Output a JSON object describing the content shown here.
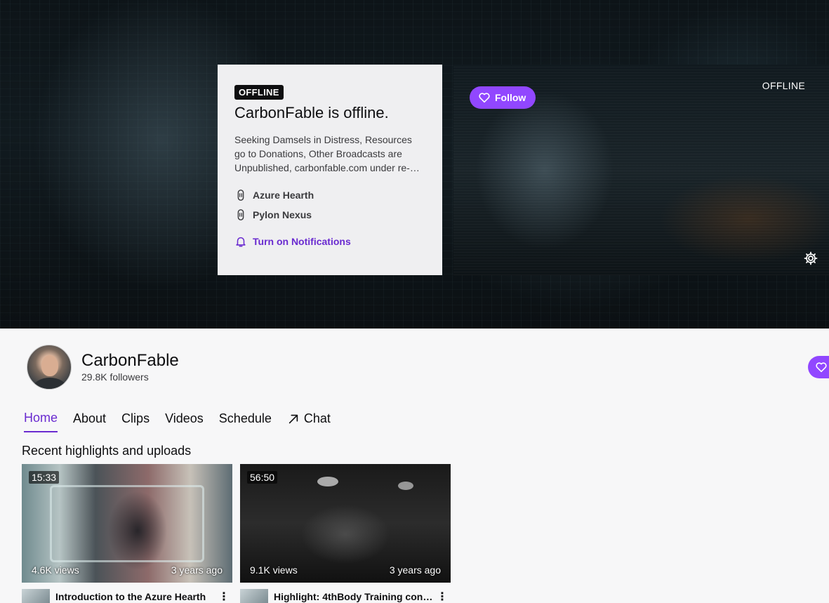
{
  "banner": {
    "offline_card": {
      "badge": "OFFLINE",
      "title": "CarbonFable is offline.",
      "description": "Seeking Damsels in Distress, Resources go to Donations, Other Broadcasts are Unpublished, carbonfable.com under re-…",
      "teams": [
        "Azure Hearth",
        "Pylon Nexus"
      ],
      "notifications_label": "Turn on Notifications"
    },
    "player": {
      "follow_label": "Follow",
      "status": "OFFLINE"
    }
  },
  "channel": {
    "name": "CarbonFable",
    "followers": "29.8K followers"
  },
  "tabs": [
    {
      "label": "Home",
      "active": true
    },
    {
      "label": "About"
    },
    {
      "label": "Clips"
    },
    {
      "label": "Videos"
    },
    {
      "label": "Schedule"
    },
    {
      "label": "Chat",
      "icon": "external-arrow-icon"
    }
  ],
  "section_title": "Recent highlights and uploads",
  "videos": [
    {
      "duration": "15:33",
      "views": "4.6K views",
      "age": "3 years ago",
      "title": "Introduction to the Azure Hearth"
    },
    {
      "duration": "56:50",
      "views": "9.1K views",
      "age": "3 years ago",
      "title": "Highlight: 4thBody Training con…"
    }
  ],
  "colors": {
    "accent": "#9147ff",
    "accent_text": "#6a2bd0"
  }
}
